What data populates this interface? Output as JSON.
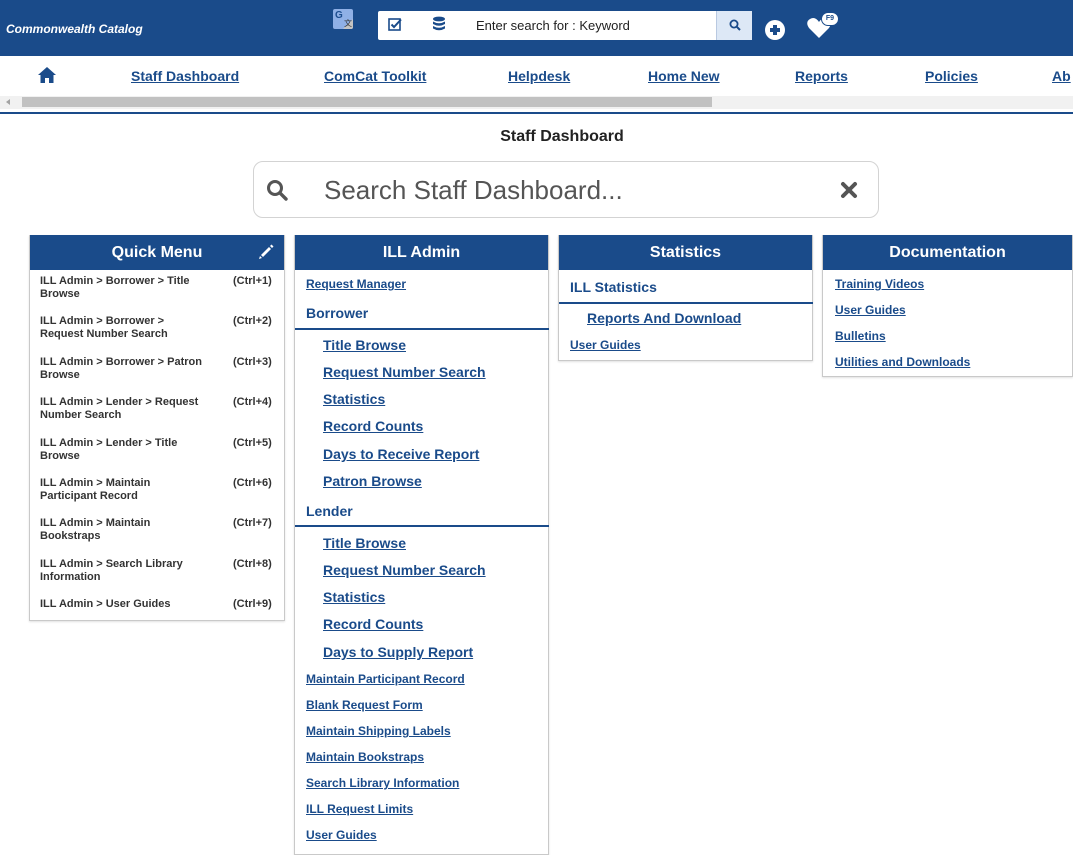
{
  "header": {
    "brand": "Commonwealth Catalog",
    "translate_icon": "google-translate-icon",
    "search": {
      "value": "Enter search for : Keyword",
      "check_icon": "checkbox-icon",
      "db_icon": "database-icon",
      "button_icon": "search-icon"
    },
    "add_icon": "plus-circle-icon",
    "favorites_badge": "F9",
    "colors": {
      "primary": "#1a4b8a",
      "search_button": "#dde8f6"
    }
  },
  "nav": {
    "home_icon": "home-icon",
    "links": [
      "Staff Dashboard",
      "ComCat Toolkit",
      "Helpdesk",
      "Home New",
      "Reports",
      "Policies",
      "Ab"
    ]
  },
  "page": {
    "title": "Staff Dashboard",
    "search_placeholder": "Search Staff Dashboard...",
    "clear_icon": "close-icon"
  },
  "quick_menu": {
    "title": "Quick Menu",
    "edit_icon": "pencil-icon",
    "items": [
      {
        "label": "ILL Admin > Borrower > Title Browse",
        "shortcut": "(Ctrl+1)"
      },
      {
        "label": "ILL Admin > Borrower > Request Number Search",
        "shortcut": "(Ctrl+2)"
      },
      {
        "label": "ILL Admin > Borrower > Patron Browse",
        "shortcut": "(Ctrl+3)"
      },
      {
        "label": "ILL Admin > Lender > Request Number Search",
        "shortcut": "(Ctrl+4)"
      },
      {
        "label": "ILL Admin > Lender > Title Browse",
        "shortcut": "(Ctrl+5)"
      },
      {
        "label": "ILL Admin > Maintain Participant Record",
        "shortcut": "(Ctrl+6)"
      },
      {
        "label": "ILL Admin > Maintain Bookstraps",
        "shortcut": "(Ctrl+7)"
      },
      {
        "label": "ILL Admin > Search Library Information",
        "shortcut": "(Ctrl+8)"
      },
      {
        "label": "ILL Admin > User Guides",
        "shortcut": "(Ctrl+9)"
      }
    ]
  },
  "ill_admin": {
    "title": "ILL Admin",
    "request_manager": "Request Manager",
    "borrower": {
      "heading": "Borrower",
      "links": [
        "Title Browse",
        "Request Number Search",
        "Statistics",
        "Record Counts",
        "Days to Receive Report",
        "Patron Browse"
      ]
    },
    "lender": {
      "heading": "Lender",
      "links": [
        "Title Browse",
        "Request Number Search",
        "Statistics",
        "Record Counts",
        "Days to Supply Report"
      ]
    },
    "more_links": [
      "Maintain Participant Record",
      "Blank Request Form",
      "Maintain Shipping Labels",
      "Maintain Bookstraps",
      "Search Library Information",
      "ILL Request Limits",
      "User Guides"
    ]
  },
  "statistics": {
    "title": "Statistics",
    "section_heading": "ILL Statistics",
    "sub_link": "Reports And Download",
    "user_guides": "User Guides"
  },
  "documentation": {
    "title": "Documentation",
    "links": [
      "Training Videos",
      "User Guides",
      "Bulletins",
      "Utilities and Downloads"
    ]
  }
}
